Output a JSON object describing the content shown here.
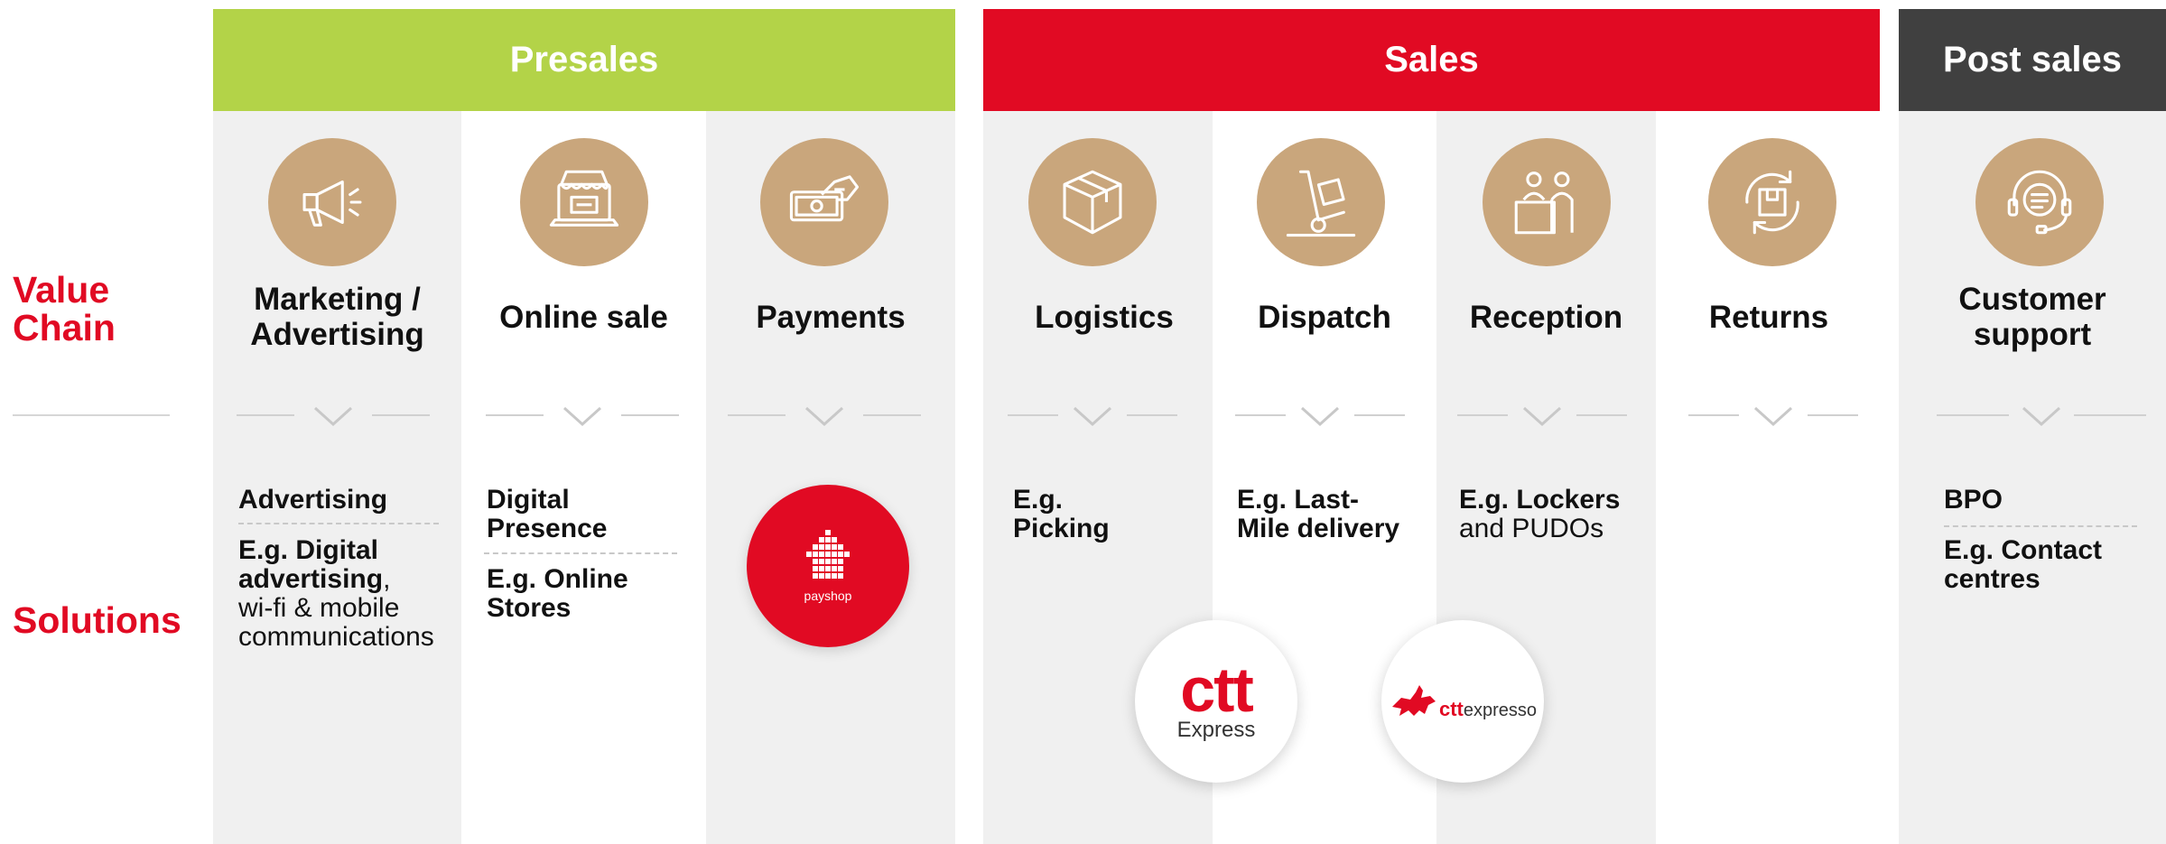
{
  "row_labels": {
    "value_chain_1": "Value",
    "value_chain_2": "Chain",
    "solutions": "Solutions"
  },
  "headers": {
    "presales": "Presales",
    "sales": "Sales",
    "post_sales": "Post sales"
  },
  "colors": {
    "presales": "#b3d348",
    "sales": "#e10a23",
    "post_sales": "#404040",
    "icon_circle": "#c9a67c",
    "accent_text": "#e10a23"
  },
  "value_chain": {
    "marketing_1": "Marketing /",
    "marketing_2": "Advertising",
    "online_sale": "Online sale",
    "payments": "Payments",
    "logistics": "Logistics",
    "dispatch": "Dispatch",
    "reception": "Reception",
    "returns": "Returns",
    "customer_1": "Customer",
    "customer_2": "support"
  },
  "icons": [
    "megaphone-icon",
    "online-store-icon",
    "payment-icon",
    "package-box-icon",
    "hand-truck-icon",
    "reception-desk-icon",
    "returns-icon",
    "customer-support-icon"
  ],
  "solutions": {
    "marketing": {
      "title": "Advertising",
      "eg_bold_1": "E.g. Digital",
      "eg_bold_2": "advertising",
      "eg_rest_2": ",",
      "eg_3": "wi-fi & mobile",
      "eg_4": "communications"
    },
    "online_sale": {
      "title_1": "Digital",
      "title_2": "Presence",
      "eg_1": "E.g. Online",
      "eg_2": "Stores"
    },
    "payments": {
      "logo_text": "payshop"
    },
    "logistics": {
      "eg_1": "E.g.",
      "eg_2": "Picking"
    },
    "dispatch": {
      "eg_1": "E.g. Last-",
      "eg_2": "Mile delivery"
    },
    "reception": {
      "eg_1": "E.g. Lockers",
      "eg_2": "and PUDOs"
    },
    "customer_support": {
      "title": "BPO",
      "eg_1": "E.g. Contact",
      "eg_2": "centres"
    }
  },
  "logos": {
    "ctt_express": {
      "main": "ctt",
      "sub": "Express"
    },
    "ctt_expresso": {
      "main": "ctt",
      "sub": "expresso"
    }
  }
}
